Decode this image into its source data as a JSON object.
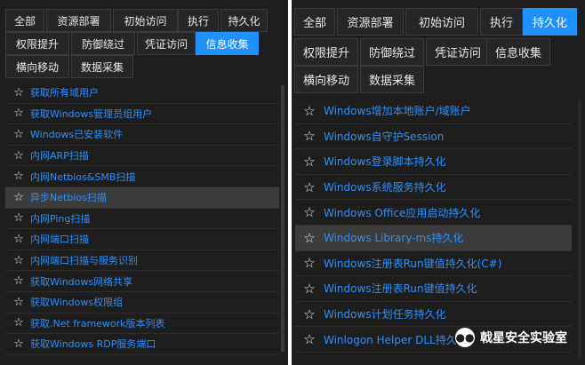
{
  "left_panel": {
    "tabs": [
      {
        "label": "全部",
        "active": false
      },
      {
        "label": "资源部署",
        "active": false
      },
      {
        "label": "初始访问",
        "active": false
      },
      {
        "label": "执行",
        "active": false
      },
      {
        "label": "持久化",
        "active": false
      },
      {
        "label": "权限提升",
        "active": false
      },
      {
        "label": "防御绕过",
        "active": false
      },
      {
        "label": "凭证访问",
        "active": false
      },
      {
        "label": "信息收集",
        "active": true
      },
      {
        "label": "横向移动",
        "active": false
      },
      {
        "label": "数据采集",
        "active": false
      }
    ],
    "items": [
      {
        "label": "获取所有域用户"
      },
      {
        "label": "获取Windows管理员组用户"
      },
      {
        "label": "Windows已安装软件"
      },
      {
        "label": "内网ARP扫描"
      },
      {
        "label": "内网Netbios&SMB扫描"
      },
      {
        "label": "异步Netbios扫描"
      },
      {
        "label": "内网Ping扫描"
      },
      {
        "label": "内网端口扫描"
      },
      {
        "label": "内网端口扫描与服务识别"
      },
      {
        "label": "获取Windows网络共享"
      },
      {
        "label": "获取Windows权限组"
      },
      {
        "label": "获取.Net framework版本列表"
      },
      {
        "label": "获取Windows RDP服务端口"
      }
    ],
    "hover_index": 5
  },
  "right_panel": {
    "tabs": [
      {
        "label": "全部",
        "active": false
      },
      {
        "label": "资源部署",
        "active": false
      },
      {
        "label": "初始访问",
        "active": false
      },
      {
        "label": "执行",
        "active": false
      },
      {
        "label": "持久化",
        "active": true
      },
      {
        "label": "权限提升",
        "active": false
      },
      {
        "label": "防御绕过",
        "active": false
      },
      {
        "label": "凭证访问",
        "active": false
      },
      {
        "label": "信息收集",
        "active": false
      },
      {
        "label": "横向移动",
        "active": false
      },
      {
        "label": "数据采集",
        "active": false
      }
    ],
    "items": [
      {
        "label": "Windows增加本地账户/域账户"
      },
      {
        "label": "Windows自守护Session"
      },
      {
        "label": "Windows登录脚本持久化"
      },
      {
        "label": "Windows系统服务持久化"
      },
      {
        "label": "Windows Office应用启动持久化"
      },
      {
        "label": "Windows Library-ms持久化"
      },
      {
        "label": "Windows注册表Run键值持久化(C#)"
      },
      {
        "label": "Windows注册表Run键值持久化"
      },
      {
        "label": "Windows计划任务持久化"
      },
      {
        "label": "Winlogon Helper DLL持久化"
      }
    ],
    "hover_index": 5
  },
  "watermark": {
    "text": "戟星安全实验室"
  },
  "icons": {
    "favorite": "star-outline-icon",
    "watermark_logo": "wechat-icon"
  },
  "colors": {
    "background": "#1e1e1e",
    "tab_active": "#1e90ff",
    "item_text": "#2f8ff7",
    "hover_row": "#3c3c3c"
  }
}
